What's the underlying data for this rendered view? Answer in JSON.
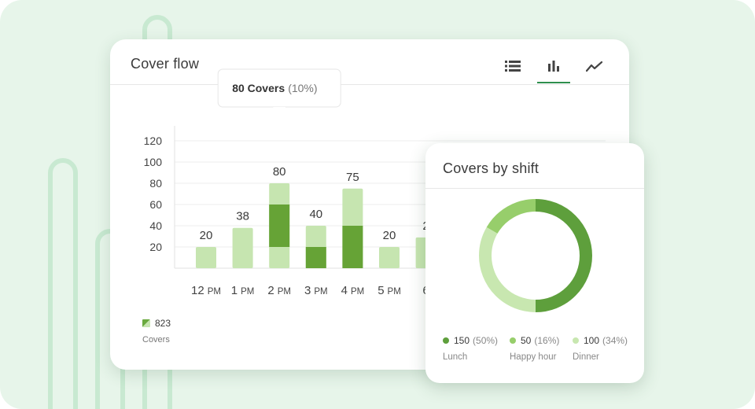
{
  "cover_flow": {
    "title": "Cover flow",
    "views": [
      {
        "name": "list",
        "icon": "list-icon",
        "active": false
      },
      {
        "name": "bar",
        "icon": "bar-chart-icon",
        "active": true
      },
      {
        "name": "line",
        "icon": "line-chart-icon",
        "active": false
      }
    ],
    "tooltip": {
      "value": "80 Covers",
      "pct": "(10%)"
    },
    "legend": {
      "total": "823",
      "label": "Covers"
    }
  },
  "covers_by_shift": {
    "title": "Covers by shift",
    "segments": [
      {
        "value": "150",
        "pct": "(50%)",
        "name": "Lunch",
        "color": "#5e9f3c"
      },
      {
        "value": "50",
        "pct": "(16%)",
        "name": "Happy hour",
        "color": "#97ce6b"
      },
      {
        "value": "100",
        "pct": "(34%)",
        "name": "Dinner",
        "color": "#c8e7b0"
      }
    ]
  },
  "chart_data": [
    {
      "type": "bar",
      "title": "Cover flow",
      "categories": [
        "12 PM",
        "1 PM",
        "2 PM",
        "3 PM",
        "4 PM",
        "5 PM",
        "6"
      ],
      "values": [
        20,
        38,
        80,
        40,
        75,
        20,
        29
      ],
      "data_labels": [
        "20",
        "38",
        "80",
        "40",
        "75",
        "20",
        "2"
      ],
      "stacked_dark": [
        [
          0,
          0
        ],
        [
          0,
          0
        ],
        [
          20,
          60
        ],
        [
          0,
          20
        ],
        [
          0,
          40
        ],
        [
          0,
          0
        ],
        [
          0,
          0
        ]
      ],
      "yticks": [
        20,
        40,
        60,
        80,
        100,
        120
      ],
      "ylim": [
        0,
        130
      ],
      "colors": {
        "light": "#c6e5b0",
        "dark": "#66a336"
      }
    },
    {
      "type": "pie",
      "title": "Covers by shift",
      "labels": [
        "Lunch",
        "Happy hour",
        "Dinner"
      ],
      "values": [
        150,
        50,
        100
      ],
      "percent": [
        50,
        16,
        34
      ]
    }
  ]
}
